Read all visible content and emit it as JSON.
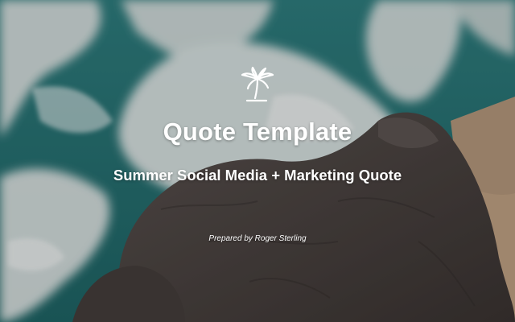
{
  "cover": {
    "logo_icon": "palm-tree-icon",
    "title": "Quote Template",
    "subtitle": "Summer Social Media + Marketing Quote",
    "prepared_by": "Prepared by Roger Sterling"
  },
  "colors": {
    "text": "#ffffff",
    "sea": "#2f7f80",
    "foam": "#d7dedd",
    "rock": "#4f4744",
    "sand": "#b89a7e"
  }
}
